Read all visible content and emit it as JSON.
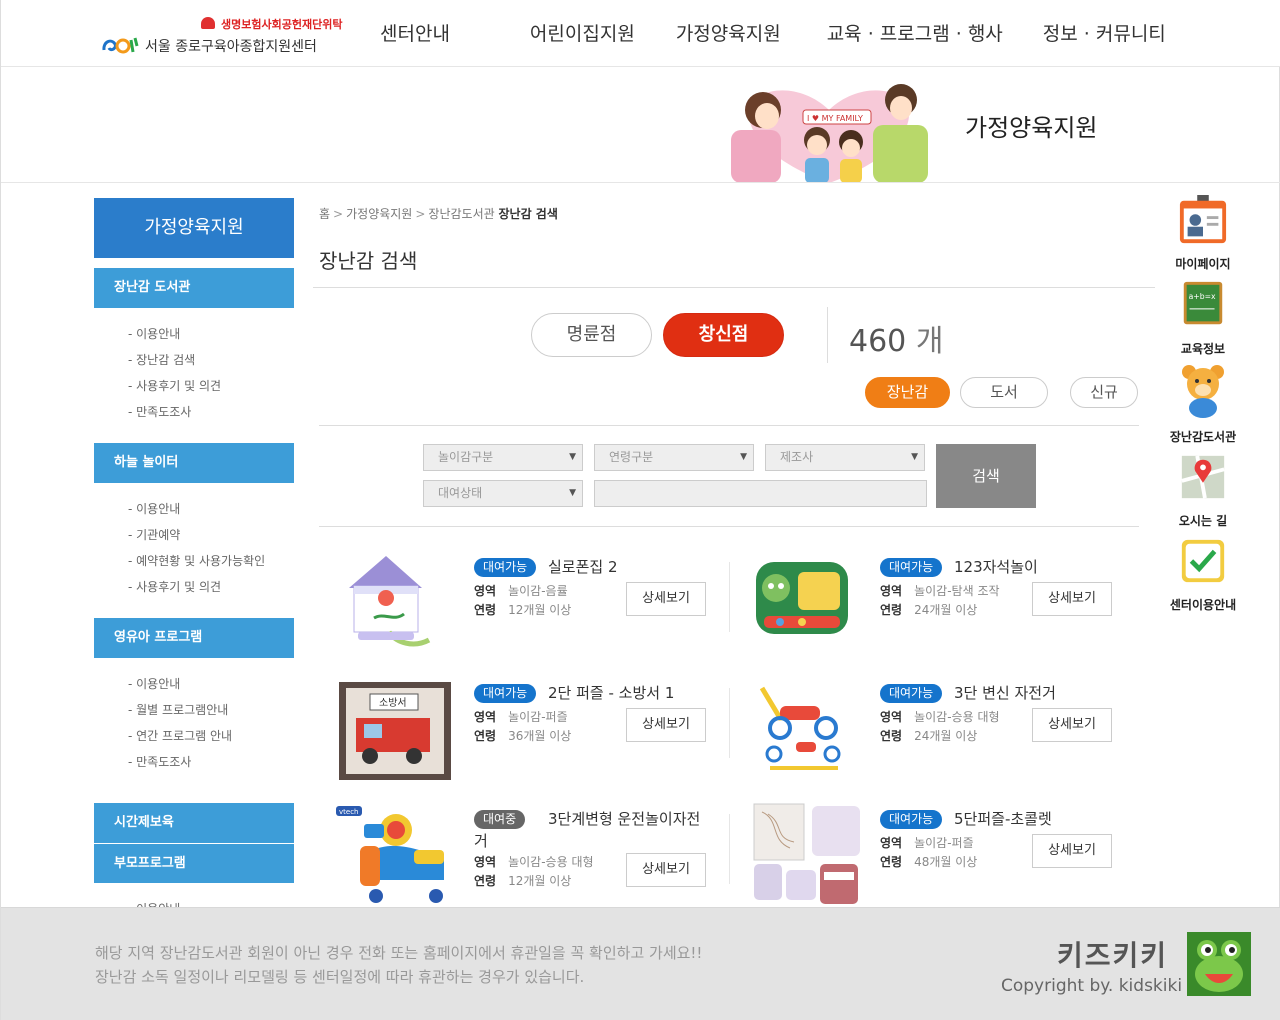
{
  "header": {
    "sponsor": "생명보험사회공헌재단위탁",
    "site_name": "서울 종로구육아종합지원센터",
    "nav": [
      "센터안내",
      "어린이집지원",
      "가정양육지원",
      "교육 · 프로그램 · 행사",
      "정보 · 커뮤니티"
    ]
  },
  "banner": {
    "title": "가정양육지원",
    "art_text": "I ♥ MY FAMILY"
  },
  "sidebar": {
    "title": "가정양육지원",
    "sections": [
      {
        "label": "장난감 도서관",
        "items": [
          "- 이용안내",
          "- 장난감 검색",
          "- 사용후기 및 의견",
          "- 만족도조사"
        ]
      },
      {
        "label": "하늘 놀이터",
        "items": [
          "- 이용안내",
          "- 기관예약",
          "- 예약현황 및 사용가능확인",
          "- 사용후기 및 의견"
        ]
      },
      {
        "label": "영유아 프로그램",
        "items": [
          "- 이용안내",
          "- 월별 프로그램안내",
          "- 연간 프로그램 안내",
          "- 만족도조사"
        ]
      },
      {
        "label": "시간제보육",
        "items": []
      },
      {
        "label": "부모프로그램",
        "items": [
          "- 이용안내"
        ]
      }
    ]
  },
  "breadcrumb": {
    "home": "홈",
    "level1": "가정양육지원",
    "level2": "장난감도서관",
    "current": "장난감 검색"
  },
  "page_title": "장난감 검색",
  "branches": {
    "a": "명륜점",
    "b": "창신점",
    "selected": "창신점"
  },
  "count": {
    "value": "460",
    "unit": "개"
  },
  "types": {
    "toy": "장난감",
    "book": "도서",
    "new": "신규",
    "selected": "장난감"
  },
  "filters": {
    "play_type": "놀이감구분",
    "age": "연령구분",
    "maker": "제조사",
    "status": "대여상태",
    "keyword": "",
    "search_label": "검색"
  },
  "products": [
    {
      "status": "대여가능",
      "name": "실로폰집 2",
      "area_label": "영역",
      "area": "놀이감-음률",
      "age_label": "연령",
      "age": "12개월 이상",
      "detail": "상세보기"
    },
    {
      "status": "대여가능",
      "name": "123자석놀이",
      "area_label": "영역",
      "area": "놀이감-탐색 조작",
      "age_label": "연령",
      "age": "24개월 이상",
      "detail": "상세보기"
    },
    {
      "status": "대여가능",
      "name": "2단 퍼즐 - 소방서 1",
      "area_label": "영역",
      "area": "놀이감-퍼즐",
      "age_label": "연령",
      "age": "36개월 이상",
      "detail": "상세보기"
    },
    {
      "status": "대여가능",
      "name": "3단 변신 자전거",
      "area_label": "영역",
      "area": "놀이감-승용 대형",
      "age_label": "연령",
      "age": "24개월 이상",
      "detail": "상세보기"
    },
    {
      "status": "대여중",
      "name": "3단계변형 운전놀이자전거",
      "area_label": "영역",
      "area": "놀이감-승용 대형",
      "age_label": "연령",
      "age": "12개월 이상",
      "detail": "상세보기"
    },
    {
      "status": "대여가능",
      "name": "5단퍼즐-초콜렛",
      "area_label": "영역",
      "area": "놀이감-퍼즐",
      "age_label": "연령",
      "age": "48개월 이상",
      "detail": "상세보기"
    }
  ],
  "product_thumb_texts": {
    "puzzle_sign": "소방서",
    "vtech": "vtech"
  },
  "quick_menu": [
    "마이페이지",
    "교육정보",
    "장난감도서관",
    "오시는 길",
    "센터이용안내"
  ],
  "quick_menu_icon_text": "a+b=x",
  "footer": {
    "notice1": "해당 지역 장난감도서관 회원이 아닌 경우  전화 또는 홈페이지에서 휴관일을 꼭 확인하고 가세요!!",
    "notice2": "장난감 소독 일정이나 리모델링 등 센터일정에 따라 휴관하는 경우가 있습니다.",
    "brand": "키즈키키",
    "copyright": "Copyright by. kidskiki"
  },
  "colors": {
    "primary": "#2b7dcb",
    "section": "#3d9dd8",
    "branch_active": "#e02f12",
    "type_active": "#f07e15",
    "badge_ok": "#1574cc",
    "badge_rented": "#666666"
  }
}
